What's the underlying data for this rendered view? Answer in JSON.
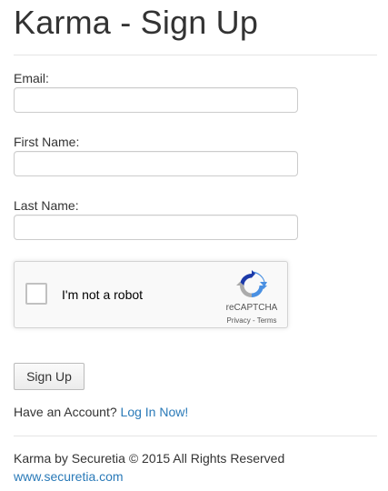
{
  "page_title": "Karma - Sign Up",
  "form": {
    "email": {
      "label": "Email:",
      "value": "",
      "placeholder": ""
    },
    "first_name": {
      "label": "First Name:",
      "value": "",
      "placeholder": ""
    },
    "last_name": {
      "label": "Last Name:",
      "value": "",
      "placeholder": ""
    }
  },
  "recaptcha": {
    "label": "I'm not a robot",
    "brand": "reCAPTCHA",
    "privacy": "Privacy",
    "separator": " - ",
    "terms": "Terms",
    "logo_icon": "recaptcha-logo-icon",
    "checked": false
  },
  "signup_button": {
    "label": "Sign Up"
  },
  "account_prompt": {
    "text": "Have an Account? ",
    "link": "Log In Now!"
  },
  "footer": {
    "copyright": "Karma by Securetia © 2015 All Rights Reserved",
    "link": "www.securetia.com"
  },
  "colors": {
    "link": "#2a7ab8",
    "text": "#333333",
    "border": "#cccccc"
  }
}
